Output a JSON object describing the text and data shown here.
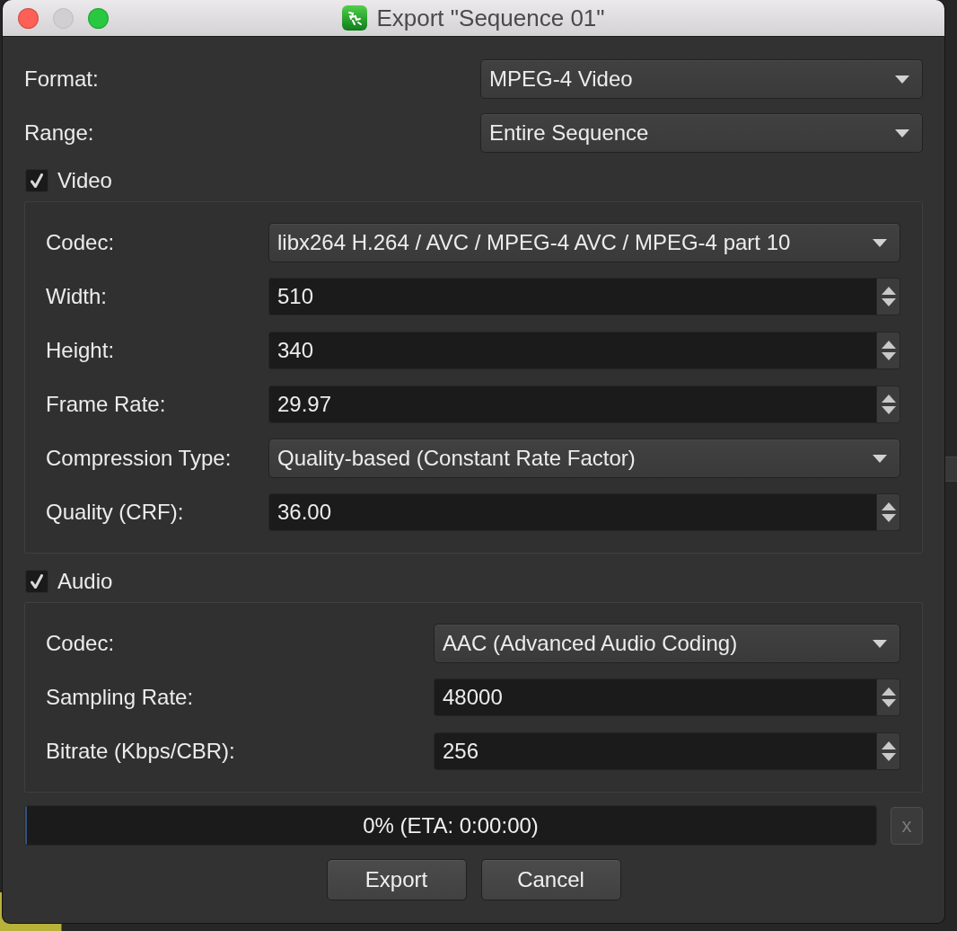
{
  "window": {
    "title": "Export \"Sequence 01\"",
    "buttons": [
      {
        "kind": "close",
        "disabled": false
      },
      {
        "kind": "minimize",
        "disabled": true
      },
      {
        "kind": "zoom",
        "disabled": false
      }
    ]
  },
  "top_fields": [
    {
      "label": "Format:",
      "kind": "dropdown",
      "value": "MPEG-4 Video"
    },
    {
      "label": "Range:",
      "kind": "dropdown",
      "value": "Entire Sequence"
    }
  ],
  "video": {
    "label": "Video",
    "checked": true,
    "fields": [
      {
        "label": "Codec:",
        "kind": "dropdown",
        "value": "libx264 H.264 / AVC / MPEG-4 AVC / MPEG-4 part 10"
      },
      {
        "label": "Width:",
        "kind": "spinbox",
        "value": "510"
      },
      {
        "label": "Height:",
        "kind": "spinbox",
        "value": "340"
      },
      {
        "label": "Frame Rate:",
        "kind": "spinbox",
        "value": "29.97"
      },
      {
        "label": "Compression Type:",
        "kind": "dropdown",
        "value": "Quality-based (Constant Rate Factor)"
      },
      {
        "label": "Quality (CRF):",
        "kind": "spinbox",
        "value": "36.00"
      }
    ]
  },
  "audio": {
    "label": "Audio",
    "checked": true,
    "fields": [
      {
        "label": "Codec:",
        "kind": "dropdown",
        "value": "AAC (Advanced Audio Coding)"
      },
      {
        "label": "Sampling Rate:",
        "kind": "spinbox",
        "value": "48000"
      },
      {
        "label": "Bitrate (Kbps/CBR):",
        "kind": "spinbox",
        "value": "256"
      }
    ]
  },
  "progress": {
    "text": "0% (ETA: 0:00:00)",
    "level": 0,
    "cancel_button": {
      "label": "x",
      "disabled": true
    }
  },
  "buttons": [
    "Export",
    "Cancel"
  ]
}
